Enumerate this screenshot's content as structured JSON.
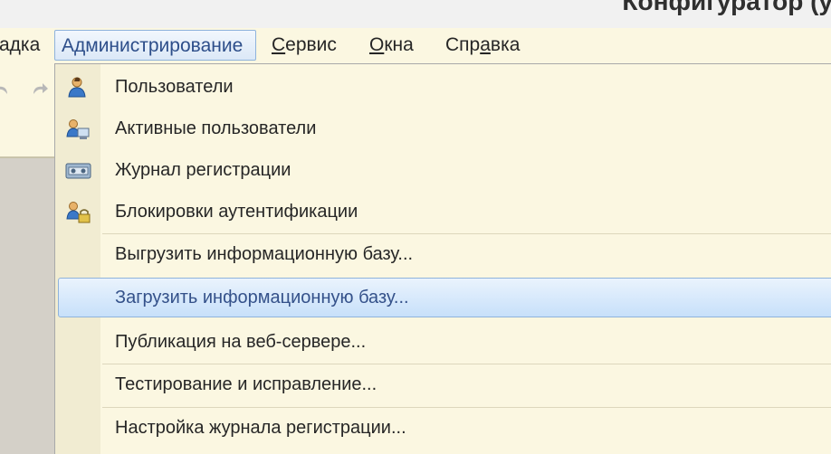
{
  "window": {
    "title": "Конфигуратор (у"
  },
  "menubar": {
    "items": [
      {
        "label": "адка",
        "mnemonic_index": -1,
        "active": false
      },
      {
        "label": "Администрирование",
        "mnemonic_index": -1,
        "active": true
      },
      {
        "label": "Сервис",
        "mnemonic_index": 0,
        "active": false
      },
      {
        "label": "Окна",
        "mnemonic_index": 0,
        "active": false
      },
      {
        "label": "Справка",
        "mnemonic_index": 3,
        "active": false
      }
    ]
  },
  "toolbar": {
    "icons": [
      "undo-icon",
      "redo-icon"
    ]
  },
  "dropdown": {
    "items": [
      {
        "label": "Пользователи",
        "icon": "user-icon"
      },
      {
        "label": "Активные пользователи",
        "icon": "active-users-icon"
      },
      {
        "label": "Журнал регистрации",
        "icon": "event-log-icon"
      },
      {
        "label": "Блокировки аутентификации",
        "icon": "user-lock-icon"
      },
      {
        "label": "Выгрузить информационную базу...",
        "icon": ""
      },
      {
        "label": "Загрузить информационную базу...",
        "icon": "",
        "highlighted": true
      },
      {
        "label": "Публикация на веб-сервере...",
        "icon": ""
      },
      {
        "label": "Тестирование и исправление...",
        "icon": ""
      },
      {
        "label": "Настройка журнала регистрации...",
        "icon": ""
      }
    ]
  },
  "colors": {
    "menu_bg": "#fbf7e1",
    "highlight_border": "#8fb3dc",
    "highlight_text": "#34518a"
  }
}
